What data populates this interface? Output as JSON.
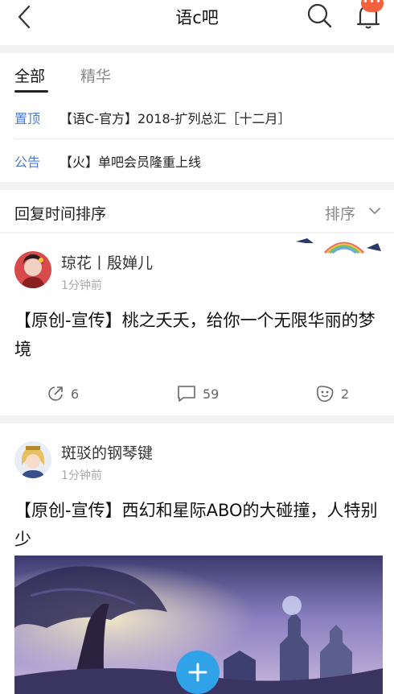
{
  "header": {
    "title": "语c吧",
    "badge": "•••"
  },
  "tabs": [
    {
      "label": "全部"
    },
    {
      "label": "精华"
    }
  ],
  "notices": [
    {
      "tag": "置顶",
      "text": "【语C-官方】2018-扩列总汇［十二月］"
    },
    {
      "tag": "公告",
      "text": "【火】单吧会员隆重上线"
    }
  ],
  "sortbar": {
    "label": "回复时间排序",
    "sort_label": "排序"
  },
  "posts": [
    {
      "username": "琼花丨殷婵儿",
      "time": "1分钟前",
      "title": "【原创-宣传】桃之夭夭，给你一个无限华丽的梦境",
      "share_count": "6",
      "comment_count": "59",
      "like_count": "2"
    },
    {
      "username": "斑驳的钢琴键",
      "time": "1分钟前",
      "title": "【原创-宣传】西幻和星际ABO的大碰撞，人特别少"
    }
  ],
  "colors": {
    "accent_blue": "#4a7bd0",
    "fab_blue": "#2fa2e8",
    "badge_red": "#f5613e"
  }
}
